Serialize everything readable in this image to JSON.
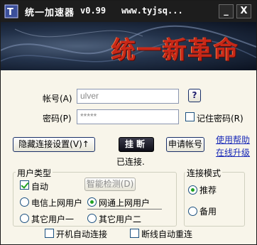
{
  "title_bar": {
    "app_name": "统一加速器",
    "version": "v0.99",
    "url": "www.tyjsq...",
    "minimize_label": "_",
    "close_label": "X"
  },
  "banner": {
    "slogan": "统一新革命"
  },
  "login": {
    "account_label": "帐号(A)",
    "account_value": "ulver",
    "password_label": "密码(P)",
    "password_value": "*****",
    "help_button_label": "?",
    "remember_password_label": "记住密码(R)",
    "remember_password_checked": false
  },
  "actions": {
    "hide_settings_label": "隐藏连接设置(V)↑",
    "hangup_label": "挂断",
    "apply_account_label": "申请帐号",
    "status_text": "已连接.",
    "help_link": "使用帮助",
    "upgrade_link": "在线升级"
  },
  "user_type": {
    "group_title": "用户类型",
    "auto_label": "自动",
    "auto_checked": true,
    "smart_detect_label": "智能检测(D)",
    "options": [
      {
        "label": "电信上网用户",
        "selected": false
      },
      {
        "label": "网通上网用户",
        "selected": true
      },
      {
        "label": "其它用户一",
        "selected": false
      },
      {
        "label": "其它用户二",
        "selected": false
      }
    ]
  },
  "connect_mode": {
    "group_title": "连接模式",
    "options": [
      {
        "label": "推荐",
        "selected": true
      },
      {
        "label": "备用",
        "selected": false
      }
    ]
  },
  "bottom": {
    "autostart_label": "开机自动连接",
    "autostart_checked": false,
    "reconnect_label": "断线自动重连",
    "reconnect_checked": false
  }
}
